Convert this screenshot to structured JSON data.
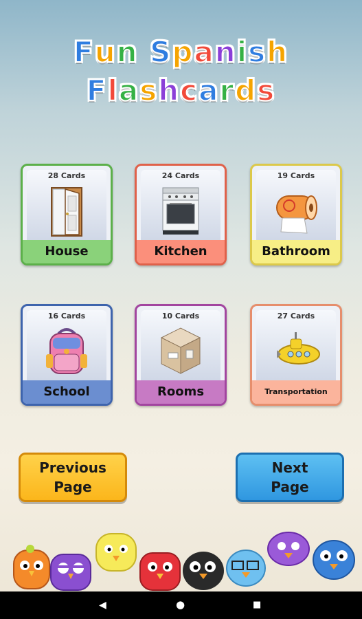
{
  "title": {
    "line1": [
      "F",
      "u",
      "n",
      " ",
      "S",
      "p",
      "a",
      "n",
      "i",
      "s",
      "h"
    ],
    "line2": [
      "F",
      "l",
      "a",
      "s",
      "h",
      "c",
      "a",
      "r",
      "d",
      "s"
    ],
    "colors1": [
      "#2f7de0",
      "#f5a400",
      "#35b145",
      "#ffffff",
      "#2f7de0",
      "#f5a400",
      "#f24a3a",
      "#8b3fd8",
      "#35b145",
      "#2f7de0",
      "#f5a400"
    ],
    "colors2": [
      "#2f7de0",
      "#f24a3a",
      "#35b145",
      "#f5a400",
      "#8b3fd8",
      "#f24a3a",
      "#2f7de0",
      "#35b145",
      "#f5a400",
      "#f24a3a"
    ]
  },
  "cards": [
    {
      "count": "28 Cards",
      "label": "House",
      "icon": "door-icon",
      "color": "#8ad27a",
      "border": "#5cb04a"
    },
    {
      "count": "24 Cards",
      "label": "Kitchen",
      "icon": "stove-icon",
      "color": "#fb8f7b",
      "border": "#e0614a"
    },
    {
      "count": "19 Cards",
      "label": "Bathroom",
      "icon": "toilet-paper-icon",
      "color": "#f7ee86",
      "border": "#dcc94a"
    },
    {
      "count": "16 Cards",
      "label": "School",
      "icon": "backpack-icon",
      "color": "#6b8ed0",
      "border": "#3e64ad"
    },
    {
      "count": "10 Cards",
      "label": "Rooms",
      "icon": "room-icon",
      "color": "#c77ac4",
      "border": "#a2459f"
    },
    {
      "count": "27 Cards",
      "label": "Transportation",
      "icon": "submarine-icon",
      "color": "#fbb49c",
      "border": "#e68e6c"
    }
  ],
  "buttons": {
    "previous": "Previous\nPage",
    "next": "Next\nPage"
  },
  "nav": {
    "back": "◀",
    "home": "●",
    "recents": "■"
  },
  "birds": [
    "orange-bird-icon",
    "purple-owl-icon",
    "yellow-bird-icon",
    "red-bird-icon",
    "black-bird-icon",
    "blue-bird-glasses-icon",
    "purple-bird-icon",
    "blue-bird-icon"
  ]
}
